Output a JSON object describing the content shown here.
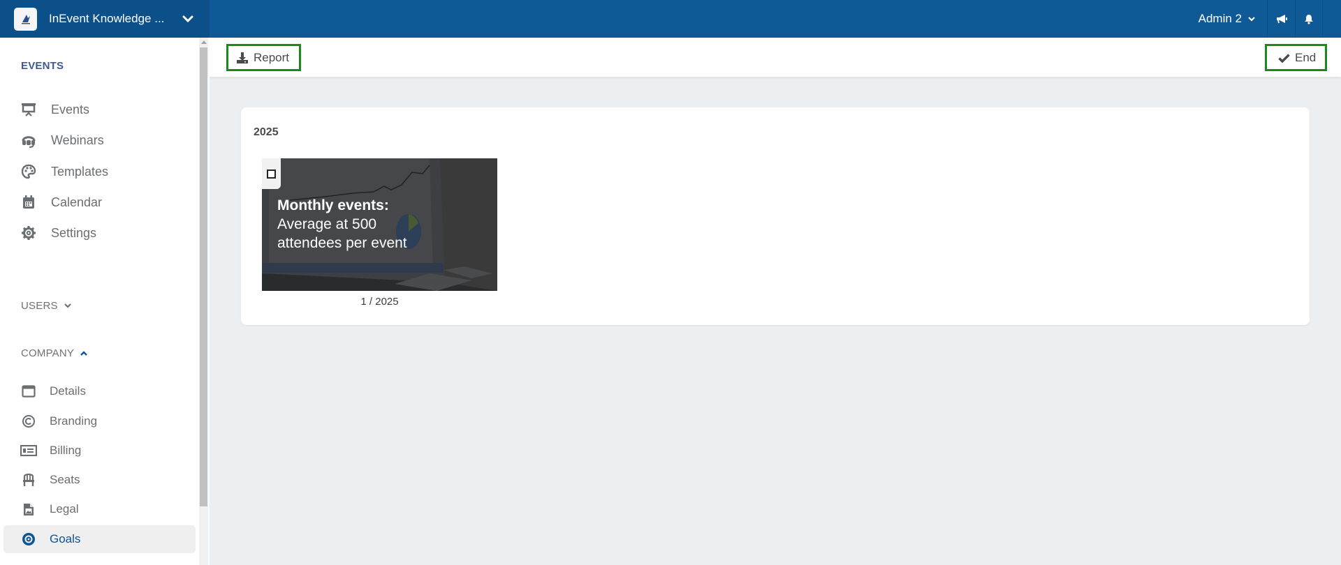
{
  "header": {
    "org_name": "InEvent Knowledge ...",
    "user_name": "Admin 2",
    "icons": [
      "logo-icon",
      "chevron-down-icon",
      "megaphone-icon",
      "bell-icon"
    ]
  },
  "sidebar": {
    "events_section": "EVENTS",
    "events_items": [
      {
        "label": "Events",
        "icon": "presentation-icon"
      },
      {
        "label": "Webinars",
        "icon": "headset-icon"
      },
      {
        "label": "Templates",
        "icon": "palette-icon"
      },
      {
        "label": "Calendar",
        "icon": "calendar-icon"
      },
      {
        "label": "Settings",
        "icon": "gear-icon"
      }
    ],
    "users_section": "USERS",
    "company_section": "COMPANY",
    "company_items": [
      {
        "label": "Details",
        "icon": "window-icon"
      },
      {
        "label": "Branding",
        "icon": "copyright-icon"
      },
      {
        "label": "Billing",
        "icon": "money-bill-icon"
      },
      {
        "label": "Seats",
        "icon": "chair-icon"
      },
      {
        "label": "Legal",
        "icon": "file-image-icon"
      },
      {
        "label": "Goals",
        "icon": "target-icon",
        "active": true
      }
    ]
  },
  "toolbar": {
    "report_label": "Report",
    "end_label": "End"
  },
  "main": {
    "year": "2025",
    "goals": [
      {
        "title": "Monthly events:",
        "line1": "Average at 500",
        "line2": "attendees per event",
        "caption": "1 / 2025",
        "checked": false
      }
    ]
  },
  "colors": {
    "header_bg": "#0f5a96",
    "accent": "#0d5593",
    "highlight_border": "#1a8a1a",
    "page_bg": "#eceff1"
  }
}
